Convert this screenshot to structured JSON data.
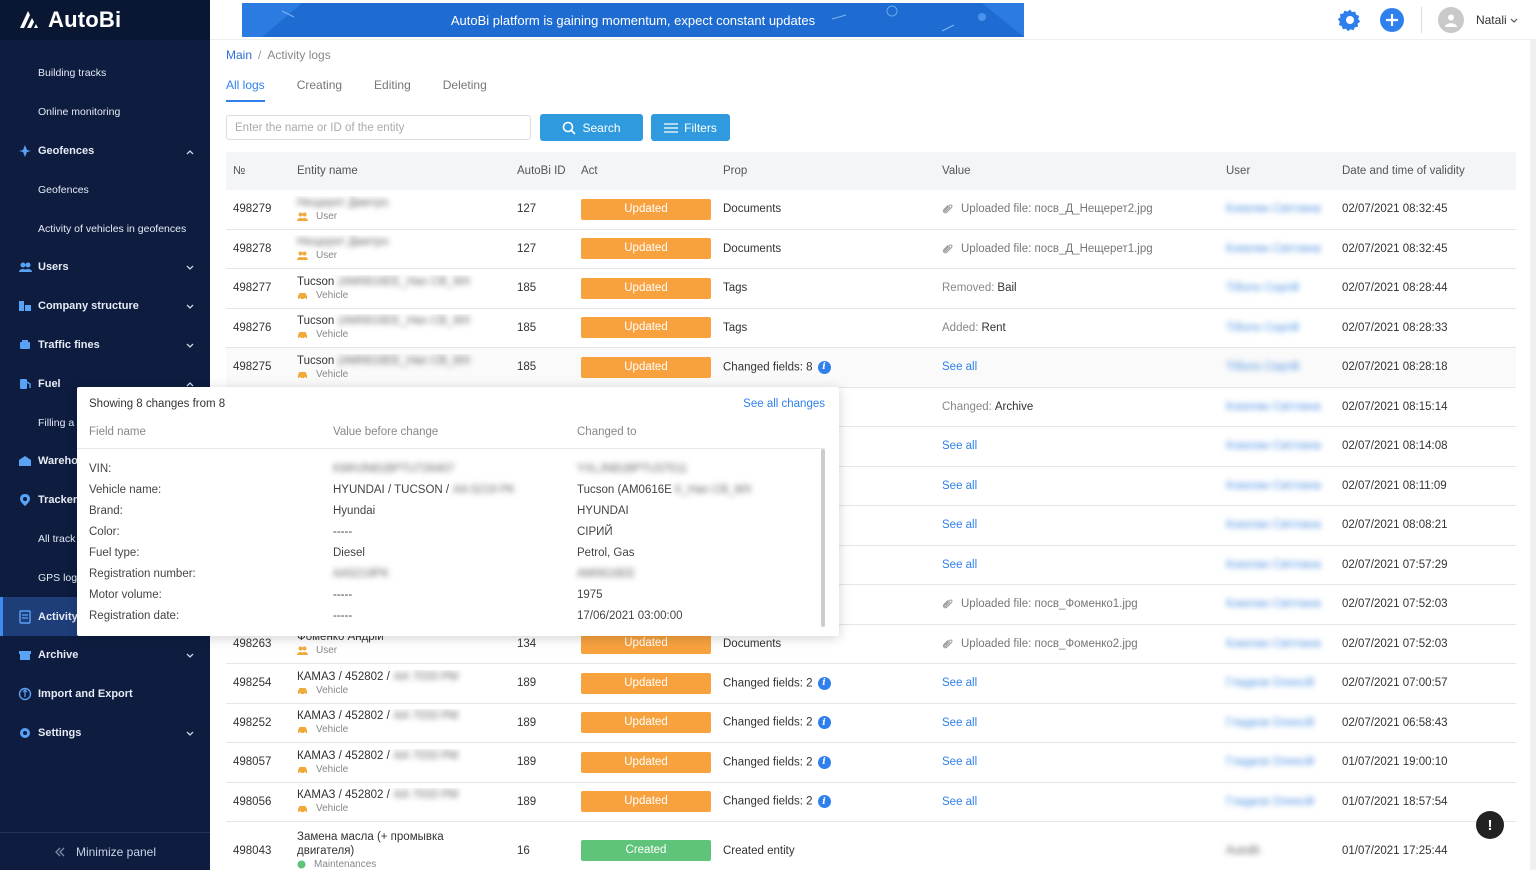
{
  "app": {
    "name": "AutoBi"
  },
  "header": {
    "banner": "AutoBi platform is gaining momentum, expect constant updates",
    "user_name": "Natali"
  },
  "sidebar": {
    "items": [
      {
        "label": "Building tracks",
        "level": "sub"
      },
      {
        "label": "Online monitoring",
        "level": "sub"
      },
      {
        "label": "Geofences",
        "level": "top",
        "icon": "geofence-icon",
        "chev": "up"
      },
      {
        "label": "Geofences",
        "level": "sub"
      },
      {
        "label": "Activity of vehicles in geofences",
        "level": "sub"
      },
      {
        "label": "Users",
        "level": "top",
        "icon": "users-icon",
        "chev": "down"
      },
      {
        "label": "Company structure",
        "level": "top",
        "icon": "structure-icon",
        "chev": "down"
      },
      {
        "label": "Traffic fines",
        "level": "top",
        "icon": "fines-icon",
        "chev": "down"
      },
      {
        "label": "Fuel",
        "level": "top",
        "icon": "fuel-icon",
        "chev": "up"
      },
      {
        "label": "Filling a",
        "level": "sub"
      },
      {
        "label": "Wareho",
        "level": "top",
        "icon": "warehouse-icon"
      },
      {
        "label": "Trackers",
        "level": "top",
        "icon": "tracker-icon"
      },
      {
        "label": "All track",
        "level": "sub"
      },
      {
        "label": "GPS log",
        "level": "sub"
      },
      {
        "label": "Activity",
        "level": "top",
        "icon": "activity-icon",
        "active": true
      },
      {
        "label": "Archive",
        "level": "top",
        "icon": "archive-icon",
        "chev": "down"
      },
      {
        "label": "Import and Export",
        "level": "top",
        "icon": "import-export-icon"
      },
      {
        "label": "Settings",
        "level": "top",
        "icon": "settings-icon",
        "chev": "down"
      }
    ],
    "minimize": "Minimize panel"
  },
  "breadcrumb": {
    "main": "Main",
    "current": "Activity logs"
  },
  "tabs": [
    "All logs",
    "Creating",
    "Editing",
    "Deleting"
  ],
  "search": {
    "placeholder": "Enter the name or ID of the entity",
    "search_label": "Search",
    "filters_label": "Filters"
  },
  "table": {
    "headers": [
      "№",
      "Entity name",
      "AutoBi ID",
      "Act",
      "Prop",
      "Value",
      "User",
      "Date and time of validity"
    ],
    "rows": [
      {
        "id": "498279",
        "name": "Нещерет Дмитро",
        "type": "User",
        "type_icon": "user",
        "name_blur": true,
        "autobi": "127",
        "act": "Updated",
        "prop": "Documents",
        "value": "Uploaded file: посв_Д_Нещерет2.jpg",
        "value_kind": "file",
        "user": "Кокелан Світлана",
        "date": "02/07/2021 08:32:45"
      },
      {
        "id": "498278",
        "name": "Нещерет Дмитро",
        "type": "User",
        "type_icon": "user",
        "name_blur": true,
        "autobi": "127",
        "act": "Updated",
        "prop": "Documents",
        "value": "Uploaded file: посв_Д_Нещерет1.jpg",
        "value_kind": "file",
        "user": "Кокелан Світлана",
        "date": "02/07/2021 08:32:45"
      },
      {
        "id": "498277",
        "name": "Tucson",
        "name_extra": "(AM0616EE_Han CB_MX",
        "type": "Vehicle",
        "type_icon": "car",
        "autobi": "185",
        "act": "Updated",
        "prop": "Tags",
        "value_label": "Removed:",
        "value": "Bail",
        "value_kind": "labeled",
        "user": "Тіболо Сергій",
        "date": "02/07/2021 08:28:44"
      },
      {
        "id": "498276",
        "name": "Tucson",
        "name_extra": "(AM0616EE_Han CB_MX",
        "type": "Vehicle",
        "type_icon": "car",
        "autobi": "185",
        "act": "Updated",
        "prop": "Tags",
        "value_label": "Added:",
        "value": "Rent",
        "value_kind": "labeled",
        "user": "Тіболо Сергій",
        "date": "02/07/2021 08:28:33"
      },
      {
        "id": "498275",
        "name": "Tucson",
        "name_extra": "(AM0616EE_Han CB_MX",
        "type": "Vehicle",
        "type_icon": "car",
        "autobi": "185",
        "act": "Updated",
        "prop": "Changed fields: 8",
        "prop_info": true,
        "value": "See all",
        "value_kind": "link",
        "user": "Тіболо Сергій",
        "date": "02/07/2021 08:28:18",
        "hover": true
      },
      {
        "id": "",
        "name": "",
        "type": "",
        "autobi": "",
        "act": "",
        "prop": "",
        "value_label": "Changed:",
        "value": "Archive",
        "value_kind": "labeled",
        "user": "Кокелан Світлана",
        "date": "02/07/2021 08:15:14"
      },
      {
        "id": "",
        "name": "",
        "type": "",
        "autobi": "",
        "act": "",
        "prop": "",
        "value": "See all",
        "value_kind": "link",
        "user": "Кокелан Світлана",
        "date": "02/07/2021 08:14:08"
      },
      {
        "id": "",
        "name": "",
        "type": "",
        "autobi": "",
        "act": "",
        "prop": "",
        "value": "See all",
        "value_kind": "link",
        "user": "Кокелан Світлана",
        "date": "02/07/2021 08:11:09"
      },
      {
        "id": "",
        "name": "",
        "type": "",
        "autobi": "",
        "act": "",
        "prop": "",
        "value": "See all",
        "value_kind": "link",
        "user": "Кокелан Світлана",
        "date": "02/07/2021 08:08:21"
      },
      {
        "id": "",
        "name": "",
        "type": "",
        "autobi": "",
        "act": "",
        "prop": "",
        "value": "See all",
        "value_kind": "link",
        "user": "Кокелан Світлана",
        "date": "02/07/2021 07:57:29"
      },
      {
        "id": "",
        "name": "",
        "type": "",
        "autobi": "",
        "act": "",
        "prop": "",
        "value": "Uploaded file: посв_Фоменко1.jpg",
        "value_kind": "file",
        "user": "Кокелан Світлана",
        "date": "02/07/2021 07:52:03"
      },
      {
        "id": "498263",
        "name": "Фоменко Андрій",
        "type": "User",
        "type_icon": "user",
        "autobi": "134",
        "act": "Updated",
        "prop": "Documents",
        "value": "Uploaded file: посв_Фоменко2.jpg",
        "value_kind": "file",
        "user": "Кокелан Світлана",
        "date": "02/07/2021 07:52:03"
      },
      {
        "id": "498254",
        "name": "КАМАЗ / 452802 /",
        "name_extra": "АА 7033 РМ",
        "type": "Vehicle",
        "type_icon": "car",
        "autobi": "189",
        "act": "Updated",
        "prop": "Changed fields: 2",
        "prop_info": true,
        "value": "See all",
        "value_kind": "link",
        "user": "Гладков Олексій",
        "date": "02/07/2021 07:00:57"
      },
      {
        "id": "498252",
        "name": "КАМАЗ / 452802 /",
        "name_extra": "АА 7033 РМ",
        "type": "Vehicle",
        "type_icon": "car",
        "autobi": "189",
        "act": "Updated",
        "prop": "Changed fields: 2",
        "prop_info": true,
        "value": "See all",
        "value_kind": "link",
        "user": "Гладков Олексій",
        "date": "02/07/2021 06:58:43"
      },
      {
        "id": "498057",
        "name": "КАМАЗ / 452802 /",
        "name_extra": "АА 7033 РМ",
        "type": "Vehicle",
        "type_icon": "car",
        "autobi": "189",
        "act": "Updated",
        "prop": "Changed fields: 2",
        "prop_info": true,
        "value": "See all",
        "value_kind": "link",
        "user": "Гладков Олексій",
        "date": "01/07/2021 19:00:10"
      },
      {
        "id": "498056",
        "name": "КАМАЗ / 452802 /",
        "name_extra": "АА 7033 РМ",
        "type": "Vehicle",
        "type_icon": "car",
        "autobi": "189",
        "act": "Updated",
        "prop": "Changed fields: 2",
        "prop_info": true,
        "value": "See all",
        "value_kind": "link",
        "user": "Гладков Олексій",
        "date": "01/07/2021 18:57:54"
      },
      {
        "id": "498043",
        "name": "Замена масла (+ промывка",
        "name2": "двигателя)",
        "type": "Maintenances",
        "type_icon": "dot",
        "autobi": "16",
        "act": "Created",
        "prop": "Created entity",
        "value": "",
        "value_kind": "text",
        "user": "AutoBi",
        "date": "01/07/2021 17:25:44",
        "tall": true
      }
    ]
  },
  "popup": {
    "title": "Showing 8 changes from 8",
    "link": "See all changes",
    "columns": [
      "Field name",
      "Value before change",
      "Changed to"
    ],
    "rows": [
      {
        "field": "VIN:",
        "before": "KMHJN81BPTU726407",
        "before_blur": true,
        "after": "YXLJN81BPTU37511",
        "after_blur": true
      },
      {
        "field": "Vehicle name:",
        "before": "HYUNDAI / TUCSON /",
        "before_extra": "AA 5219 PK",
        "after": "Tucson (AM0616E",
        "after_extra": "X_Han CB_MX"
      },
      {
        "field": "Brand:",
        "before": "Hyundai",
        "after": "HYUNDAI"
      },
      {
        "field": "Color:",
        "before": "-----",
        "after": "СІРИЙ"
      },
      {
        "field": "Fuel type:",
        "before": "Diesel",
        "after": "Petrol, Gas"
      },
      {
        "field": "Registration number:",
        "before": "AA5219PK",
        "before_blur": true,
        "after": "AM0616EE",
        "after_blur": true
      },
      {
        "field": "Motor volume:",
        "before": "-----",
        "after": "1975"
      },
      {
        "field": "Registration date:",
        "before": "-----",
        "after": "17/06/2021 03:00:00"
      }
    ]
  },
  "colors": {
    "sidebar_bg": "#0d1c3f",
    "accent": "#2f80ed",
    "updated": "#f7a23e",
    "created": "#5fc47a",
    "button": "#2f9bde"
  }
}
